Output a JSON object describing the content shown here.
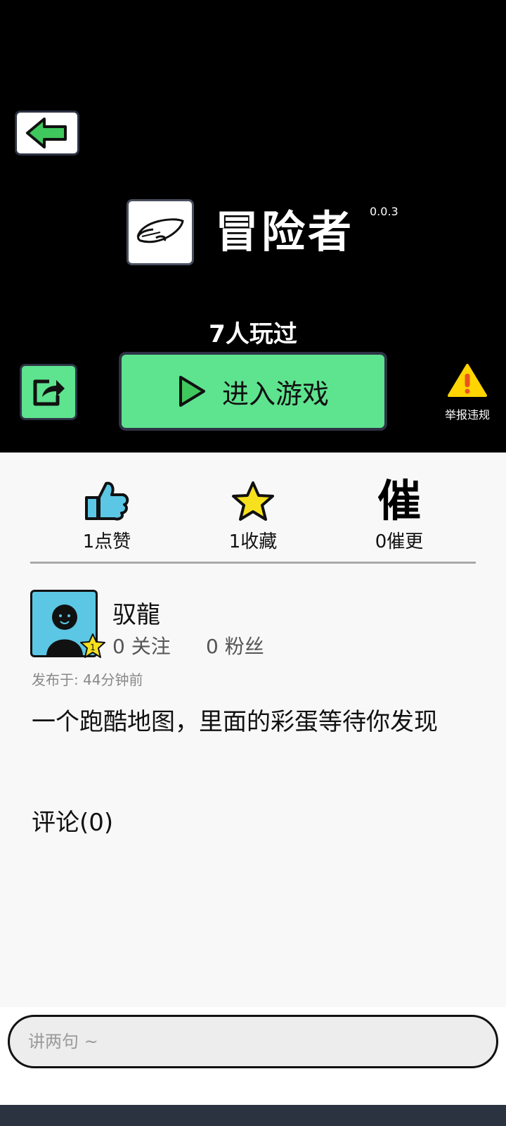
{
  "game": {
    "title": "冒险者",
    "version": "0.0.3",
    "played_count": "7人玩过"
  },
  "actions": {
    "play_label": "进入游戏",
    "report_label": "举报违规"
  },
  "stats": {
    "likes_label": "1点赞",
    "favorites_label": "1收藏",
    "urge_glyph": "催",
    "urge_label": "0催更"
  },
  "author": {
    "name": "驭龍",
    "level": "1",
    "follow_label": "0 关注",
    "fans_label": "0 粉丝",
    "published": "发布于: 44分钟前"
  },
  "description": "一个跑酷地图，里面的彩蛋等待你发现",
  "comments": {
    "title": "评论(0)",
    "input_placeholder": "讲两句 ~"
  },
  "colors": {
    "accent_green": "#5ee38f",
    "avatar_blue": "#5bc7e5",
    "star_yellow": "#f7e11e",
    "thumb_blue": "#5bc7e5",
    "warning_yellow": "#ffd400"
  },
  "icons": [
    "back-arrow-icon",
    "game-logo-icon",
    "share-icon",
    "play-icon",
    "warning-icon",
    "thumbs-up-icon",
    "star-icon",
    "level-star-icon"
  ]
}
